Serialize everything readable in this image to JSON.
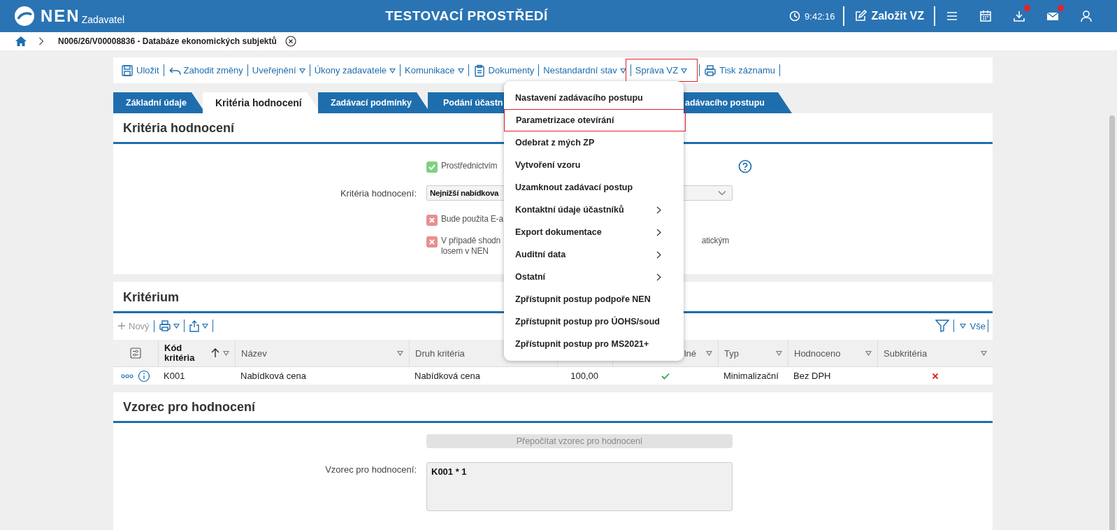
{
  "header": {
    "logo_text": "NEN",
    "logo_subtitle": "Zadavatel",
    "title": "TESTOVACÍ PROSTŘEDÍ",
    "time": "9:42:16",
    "create_button": "Založit VZ",
    "icons": [
      {
        "kind": "menu",
        "badge": false
      },
      {
        "kind": "calendar",
        "badge": false
      },
      {
        "kind": "download",
        "badge": true
      },
      {
        "kind": "mail",
        "badge": true
      },
      {
        "kind": "user",
        "badge": false
      }
    ]
  },
  "breadcrumb": {
    "text": "N006/26/V00008836 - Databáze ekonomických subjektů"
  },
  "toolbar": [
    {
      "label": "Uložit",
      "kind": "save",
      "highlighted": false
    },
    {
      "label": "Zahodit změny",
      "kind": "undo",
      "highlighted": false
    },
    {
      "label": "Uveřejnění",
      "kind": "dropdown",
      "highlighted": false
    },
    {
      "label": "Úkony zadavatele",
      "kind": "dropdown",
      "highlighted": false
    },
    {
      "label": "Komunikace",
      "kind": "dropdown",
      "highlighted": false
    },
    {
      "label": "Dokumenty",
      "kind": "document",
      "highlighted": false
    },
    {
      "label": "Nestandardní stav",
      "kind": "dropdown",
      "highlighted": false
    },
    {
      "label": "Správa VZ",
      "kind": "dropdown",
      "highlighted": true
    },
    {
      "label": "Tisk záznamu",
      "kind": "print",
      "highlighted": false
    }
  ],
  "tabs": [
    {
      "label": "Základní údaje",
      "selected": false
    },
    {
      "label": "Kritéria hodnocení",
      "selected": true
    },
    {
      "label": "Zadávací podmínky",
      "selected": false
    },
    {
      "label": "Podání účastn",
      "selected": false
    },
    {
      "label": "adávacího postupu",
      "selected": false
    }
  ],
  "criteria_panel": {
    "title": "Kritéria hodnocení",
    "rows": [
      {
        "kind": "check",
        "checked": true,
        "text": "Prostřednictvím",
        "help": true
      },
      {
        "kind": "select",
        "label": "Kritéria hodnocení:",
        "value": "Nejnižší nabídkova"
      },
      {
        "kind": "check",
        "checked": false,
        "text": "Bude použita E-a"
      },
      {
        "kind": "check",
        "checked": false,
        "text": "V případě shodn",
        "text_right": "atickým",
        "text_line2": "losem v NEN"
      }
    ]
  },
  "criterion_panel": {
    "title": "Kritérium",
    "new_label": "Nový",
    "new_disabled": true,
    "filter_label": "Vše",
    "columns": [
      {
        "label": "Kód kritéria",
        "sorted": true,
        "filter": true
      },
      {
        "label": "Název",
        "filter": true
      },
      {
        "label": "Druh kritéria"
      },
      {
        "filter": false
      },
      {
        "label": "lné",
        "filter": true
      },
      {
        "label": "Typ",
        "filter": true
      },
      {
        "label": "Hodnoceno",
        "filter": true
      },
      {
        "label": "Subkritéria",
        "filter": true
      }
    ],
    "rows": [
      {
        "cells": [
          {
            "kind": "text",
            "text": "K001"
          },
          {
            "kind": "text",
            "text": "Nabídková cena"
          },
          {
            "kind": "text",
            "text": "Nabídková cena"
          },
          {
            "kind": "number",
            "text": "100,00"
          },
          {
            "kind": "bool",
            "value": true
          },
          {
            "kind": "text",
            "text": "Minimalizační"
          },
          {
            "kind": "text",
            "text": "Bez DPH"
          },
          {
            "kind": "bool",
            "value": false
          }
        ]
      }
    ]
  },
  "formula_panel": {
    "title": "Vzorec pro hodnocení",
    "button": {
      "label": "Přepočítat vzorec pro hodnocení",
      "disabled": true
    },
    "field": {
      "label": "Vzorec pro hodnocení:",
      "value": "K001 * 1"
    }
  },
  "menu": {
    "items": [
      {
        "label": "Nastavení zadávacího postupu",
        "submenu": false,
        "highlighted": false
      },
      {
        "label": "Parametrizace otevírání",
        "submenu": false,
        "highlighted": true
      },
      {
        "label": "Odebrat z mých ZP",
        "submenu": false,
        "highlighted": false
      },
      {
        "label": "Vytvoření vzoru",
        "submenu": false,
        "highlighted": false
      },
      {
        "label": "Uzamknout zadávací postup",
        "submenu": false,
        "highlighted": false
      },
      {
        "label": "Kontaktní údaje účastníků",
        "submenu": true,
        "highlighted": false
      },
      {
        "label": "Export dokumentace",
        "submenu": true,
        "highlighted": false
      },
      {
        "label": "Auditní data",
        "submenu": true,
        "highlighted": false
      },
      {
        "label": "Ostatní",
        "submenu": true,
        "highlighted": false
      },
      {
        "label": "Zpřístupnit postup podpoře NEN",
        "submenu": false,
        "highlighted": false
      },
      {
        "label": "Zpřístupnit postup pro ÚOHS/soud",
        "submenu": false,
        "highlighted": false
      },
      {
        "label": "Zpřístupnit postup pro MS2021+",
        "submenu": false,
        "highlighted": false
      }
    ]
  }
}
